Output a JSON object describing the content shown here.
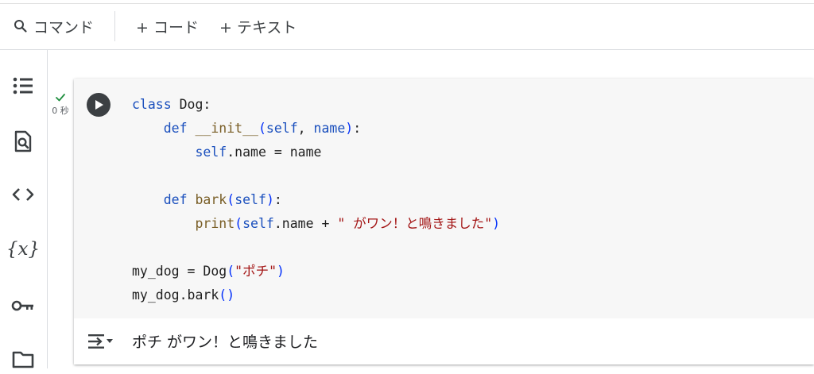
{
  "toolbar": {
    "command_label": "コマンド",
    "add_code_label": "+ コード",
    "add_text_label": "+ テキスト"
  },
  "sidebar": {
    "items": [
      {
        "icon": "table-of-contents-icon"
      },
      {
        "icon": "find-replace-icon"
      },
      {
        "icon": "code-snippets-icon"
      },
      {
        "icon": "variables-icon",
        "label": "{x}"
      },
      {
        "icon": "secrets-key-icon"
      },
      {
        "icon": "files-folder-icon"
      }
    ]
  },
  "cell": {
    "status_icon": "check-icon",
    "exec_time": "0 秒",
    "code_lines": [
      "class Dog:",
      "    def __init__(self, name):",
      "        self.name = name",
      "",
      "    def bark(self):",
      "        print(self.name + \" がワン！と鳴きました\")",
      "",
      "my_dog = Dog(\"ポチ\")",
      "my_dog.bark()"
    ],
    "output_text": "ポチ がワン！と鳴きました"
  },
  "colors": {
    "keyword": "#1a4fbd",
    "function": "#795e26",
    "string": "#a31515",
    "check": "#1e8e3e"
  }
}
